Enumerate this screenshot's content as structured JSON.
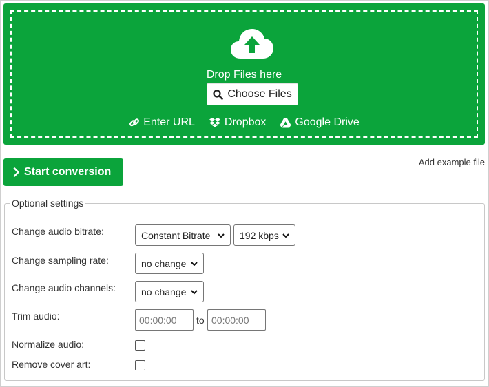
{
  "upload": {
    "drop_text": "Drop Files here",
    "choose_label": "Choose Files",
    "sources": [
      {
        "icon": "link-icon",
        "label": "Enter URL"
      },
      {
        "icon": "dropbox-icon",
        "label": "Dropbox"
      },
      {
        "icon": "google-drive-icon",
        "label": "Google Drive"
      }
    ]
  },
  "start_label": "Start conversion",
  "example_label": "Add example file",
  "settings": {
    "legend": "Optional settings",
    "bitrate_label": "Change audio bitrate:",
    "bitrate_mode": "Constant Bitrate",
    "bitrate_value": "192 kbps",
    "sampling_label": "Change sampling rate:",
    "sampling_value": "no change",
    "channels_label": "Change audio channels:",
    "channels_value": "no change",
    "trim_label": "Trim audio:",
    "trim_start_placeholder": "00:00:00",
    "trim_to": "to",
    "trim_end_placeholder": "00:00:00",
    "normalize_label": "Normalize audio:",
    "remove_cover_label": "Remove cover art:"
  },
  "colors": {
    "accent": "#0ba43b"
  }
}
